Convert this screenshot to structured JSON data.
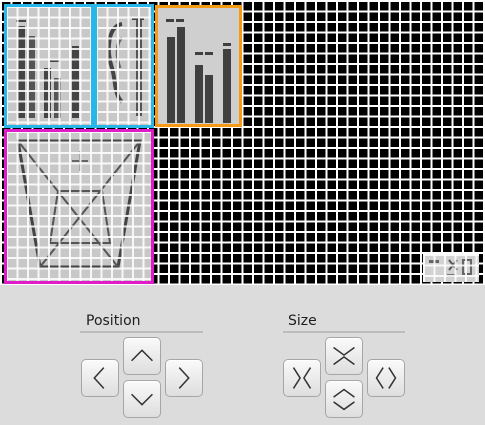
{
  "controls": {
    "position": {
      "label": "Position",
      "buttons": [
        {
          "name": "position-up-button",
          "icon": "arrow-up-icon"
        },
        {
          "name": "position-left-button",
          "icon": "arrow-left-icon"
        },
        {
          "name": "position-right-button",
          "icon": "arrow-right-icon"
        },
        {
          "name": "position-down-button",
          "icon": "arrow-down-icon"
        }
      ]
    },
    "size": {
      "label": "Size",
      "buttons": [
        {
          "name": "size-shrink-vertical-button",
          "icon": "shrink-vertical-icon"
        },
        {
          "name": "size-shrink-horizontal-button",
          "icon": "shrink-horizontal-icon"
        },
        {
          "name": "size-grow-horizontal-button",
          "icon": "grow-horizontal-icon"
        },
        {
          "name": "size-grow-vertical-button",
          "icon": "grow-vertical-icon"
        }
      ]
    }
  },
  "colors": {
    "selection_cyan": "#29b6e8",
    "selection_orange": "#f59a16",
    "selection_magenta": "#e01cc9",
    "canvas_background": "#000000",
    "grid_lines": "#ffffff"
  }
}
